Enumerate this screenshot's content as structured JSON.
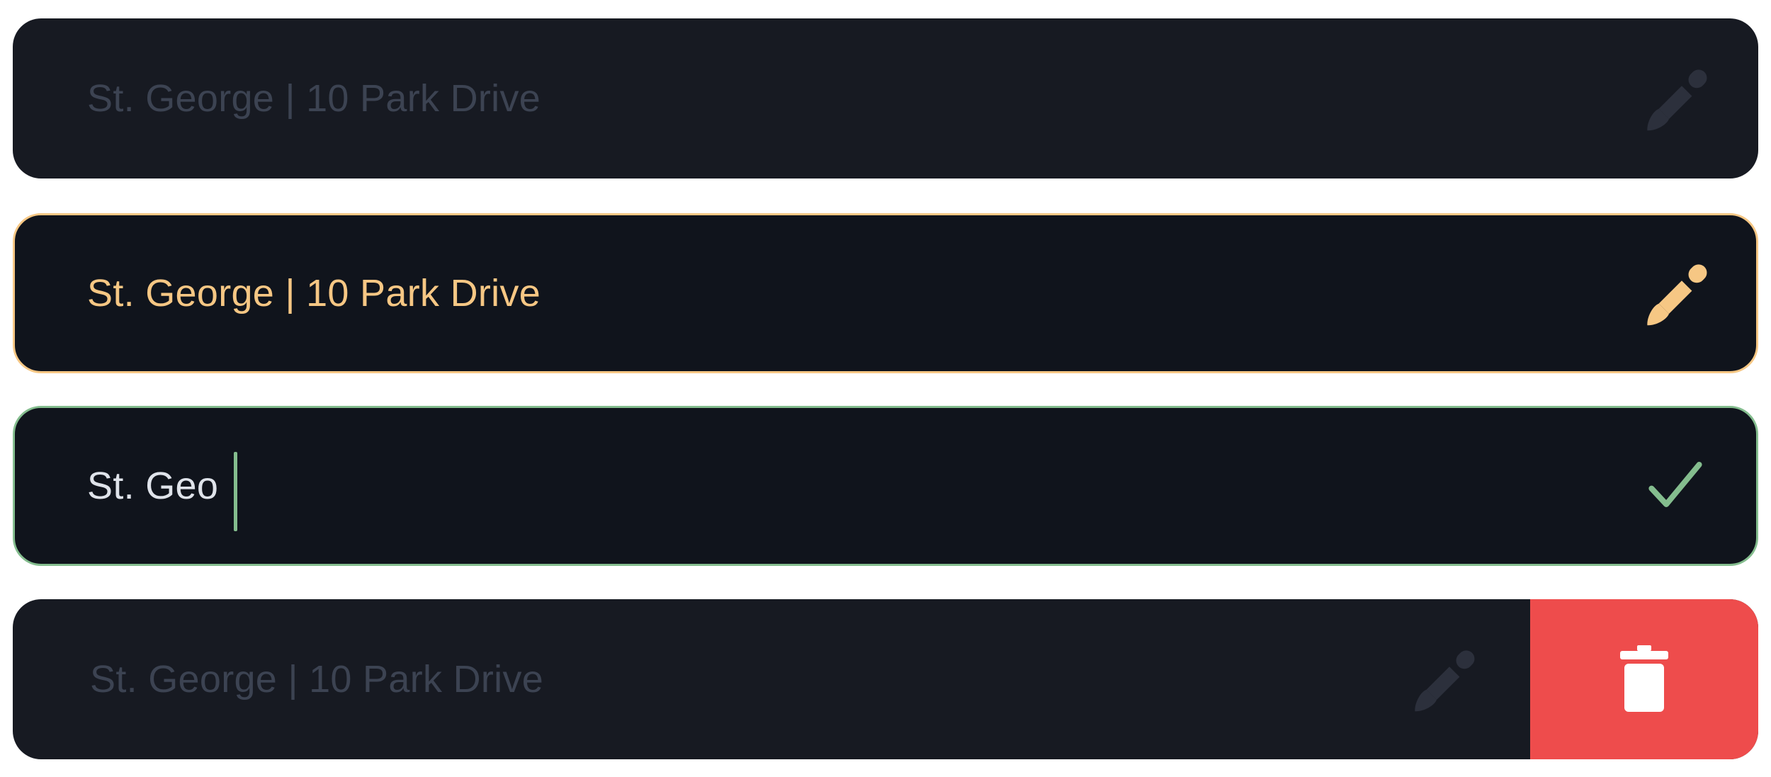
{
  "fields": [
    {
      "state": "default",
      "value": "St. George | 10 Park Drive",
      "action_icon": "pencil-icon"
    },
    {
      "state": "hover",
      "value": "St. George | 10 Park Drive",
      "action_icon": "pencil-icon"
    },
    {
      "state": "editing",
      "value": "St. Geo",
      "action_icon": "check-icon"
    },
    {
      "state": "swiped",
      "value": "St. George | 10 Park Drive",
      "action_icon": "pencil-icon",
      "delete_icon": "trash-icon"
    }
  ],
  "colors": {
    "field_bg": "#171a22",
    "field_bg_active": "#10141c",
    "muted_text": "#3c4352",
    "accent_orange": "#f6c784",
    "accent_green": "#84bd8e",
    "input_text": "#dfe3ea",
    "danger": "#ee4c4c"
  }
}
